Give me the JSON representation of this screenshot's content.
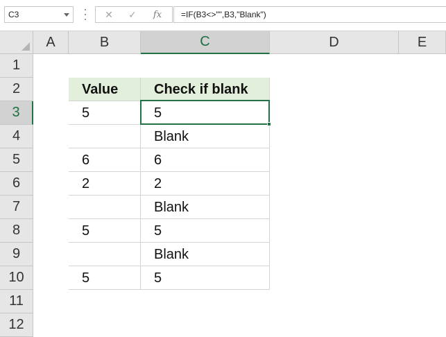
{
  "name_box": {
    "value": "C3"
  },
  "formula_bar": {
    "cancel_icon": "✕",
    "enter_icon": "✓",
    "fx_label": "fx",
    "formula": "=IF(B3<>\"\",B3,\"Blank\")"
  },
  "columns": [
    "A",
    "B",
    "C",
    "D",
    "E"
  ],
  "rows": [
    "1",
    "2",
    "3",
    "4",
    "5",
    "6",
    "7",
    "8",
    "9",
    "10",
    "11",
    "12"
  ],
  "table": {
    "headers": [
      "Value",
      "Check if blank"
    ],
    "rows": [
      [
        "5",
        "5"
      ],
      [
        "",
        "Blank"
      ],
      [
        "6",
        "6"
      ],
      [
        "2",
        "2"
      ],
      [
        "",
        "Blank"
      ],
      [
        "5",
        "5"
      ],
      [
        "",
        "Blank"
      ],
      [
        "5",
        "5"
      ]
    ]
  },
  "colors": {
    "header_fill": "#e2efda",
    "selection": "#217346"
  }
}
